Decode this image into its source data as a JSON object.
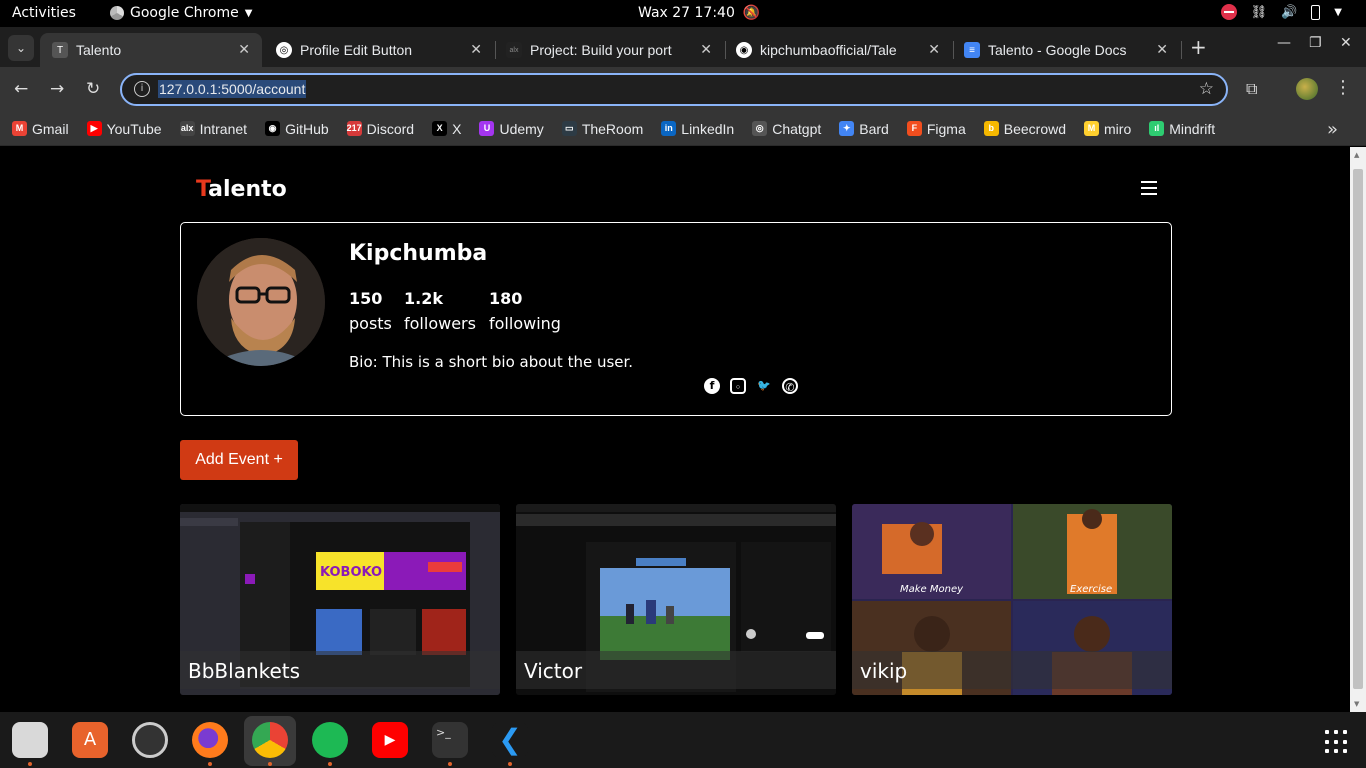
{
  "topbar": {
    "activities": "Activities",
    "app_name": "Google Chrome",
    "clock": "Wax 27  17:40"
  },
  "tabs": [
    {
      "title": "Talento",
      "active": true
    },
    {
      "title": "Profile Edit Button",
      "active": false
    },
    {
      "title": "Project: Build your port",
      "active": false
    },
    {
      "title": "kipchumbaofficial/Tale",
      "active": false
    },
    {
      "title": "Talento - Google Docs",
      "active": false
    }
  ],
  "address_bar": {
    "url": "127.0.0.1:5000/account"
  },
  "bookmarks": [
    {
      "label": "Gmail",
      "color": "#ea4335",
      "glyph": "M"
    },
    {
      "label": "YouTube",
      "color": "#ff0000",
      "glyph": "▶"
    },
    {
      "label": "Intranet",
      "color": "#444444",
      "glyph": "alx"
    },
    {
      "label": "GitHub",
      "color": "#000000",
      "glyph": "◉"
    },
    {
      "label": "Discord",
      "color": "#d63a3a",
      "glyph": "217"
    },
    {
      "label": "X",
      "color": "#000000",
      "glyph": "X"
    },
    {
      "label": "Udemy",
      "color": "#a435f0",
      "glyph": "U"
    },
    {
      "label": "TheRoom",
      "color": "#2d3b45",
      "glyph": "▭"
    },
    {
      "label": "LinkedIn",
      "color": "#0a66c2",
      "glyph": "in"
    },
    {
      "label": "Chatgpt",
      "color": "#555555",
      "glyph": "◎"
    },
    {
      "label": "Bard",
      "color": "#4285f4",
      "glyph": "✦"
    },
    {
      "label": "Figma",
      "color": "#f24e1e",
      "glyph": "F"
    },
    {
      "label": "Beecrowd",
      "color": "#f5b800",
      "glyph": "b"
    },
    {
      "label": "miro",
      "color": "#ffd02f",
      "glyph": "M"
    },
    {
      "label": "Mindrift",
      "color": "#2ecc71",
      "glyph": "ıl"
    }
  ],
  "site": {
    "brand_first": "T",
    "brand_rest": "alento"
  },
  "profile": {
    "username": "Kipchumba",
    "posts_count": "150",
    "posts_label": "posts",
    "followers_count": "1.2k",
    "followers_label": "followers",
    "following_count": "180",
    "following_label": "following",
    "bio": "Bio: This is a short bio about the user."
  },
  "actions": {
    "add_event": "Add Event +"
  },
  "events": [
    {
      "name": "BbBlankets",
      "thumb_colors": [
        "#1a1a22",
        "#f7e32a",
        "#8b1ab8",
        "#ea3c3c"
      ]
    },
    {
      "name": "Victor",
      "thumb_colors": [
        "#101010",
        "#4a7fc4",
        "#3a8a3a",
        "#cfd6e0"
      ]
    },
    {
      "name": "vikip",
      "thumb_colors": [
        "#2a2450",
        "#d56a2a",
        "#3a6a3a",
        "#c48a2a"
      ],
      "captions": [
        "Make Money",
        "Exercise"
      ]
    }
  ]
}
